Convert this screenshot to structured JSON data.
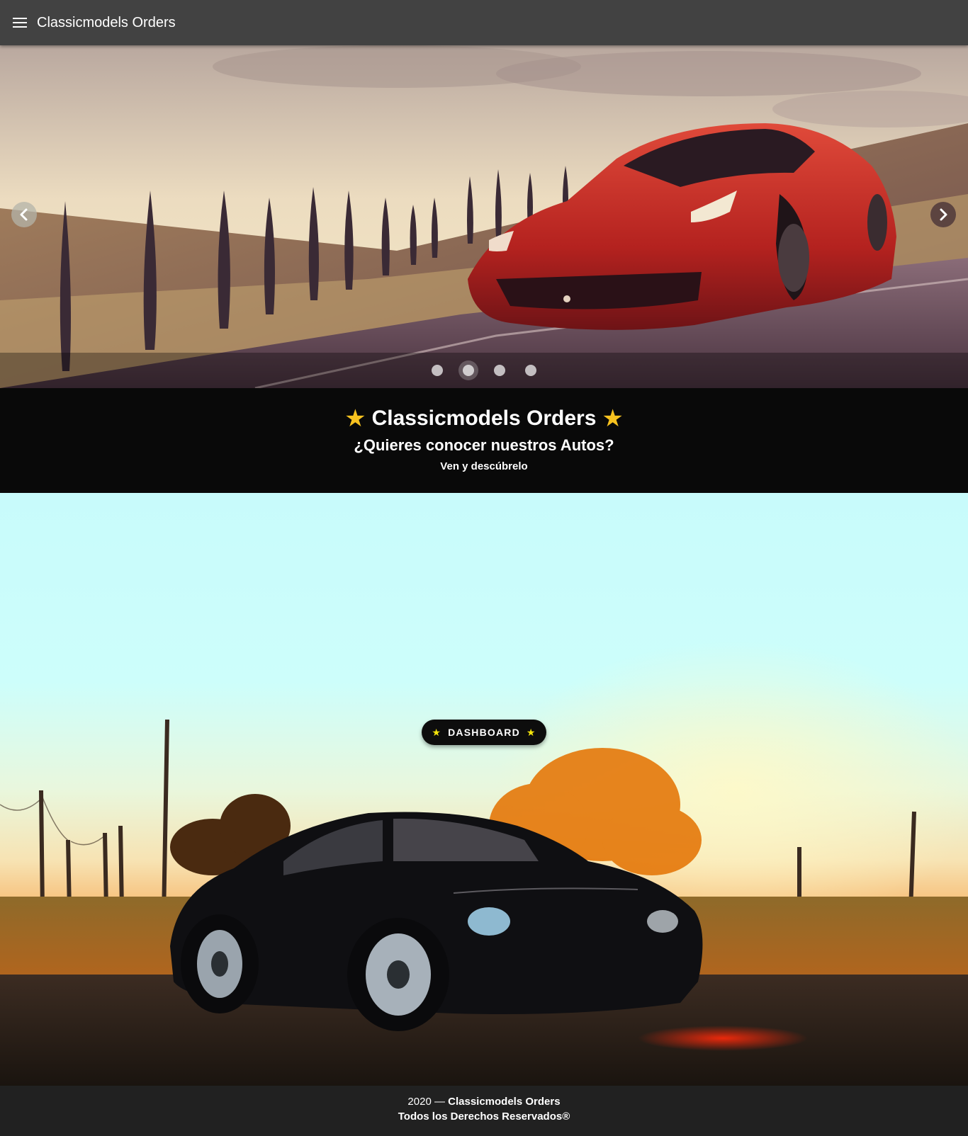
{
  "appbar": {
    "menu_icon": "menu-icon",
    "title": "Classicmodels Orders"
  },
  "carousel": {
    "slide_count": 4,
    "active_index": 1,
    "prev_icon": "chevron-left-icon",
    "next_icon": "chevron-right-icon"
  },
  "intro": {
    "title": "Classicmodels Orders",
    "star_glyph": "★",
    "subtitle": "¿Quieres conocer nuestros Autos?",
    "tagline": "Ven y descúbrelo"
  },
  "hero": {
    "button_label": "DASHBOARD",
    "button_star": "★"
  },
  "footer": {
    "year": "2020",
    "dash": " — ",
    "brand": "Classicmodels Orders",
    "rights": "Todos los Derechos Reservados®"
  },
  "colors": {
    "appbar": "#424242",
    "intro_bg": "#090909",
    "star": "#f7c21f",
    "button_star": "#f5e50b",
    "footer_bg": "#212121"
  }
}
